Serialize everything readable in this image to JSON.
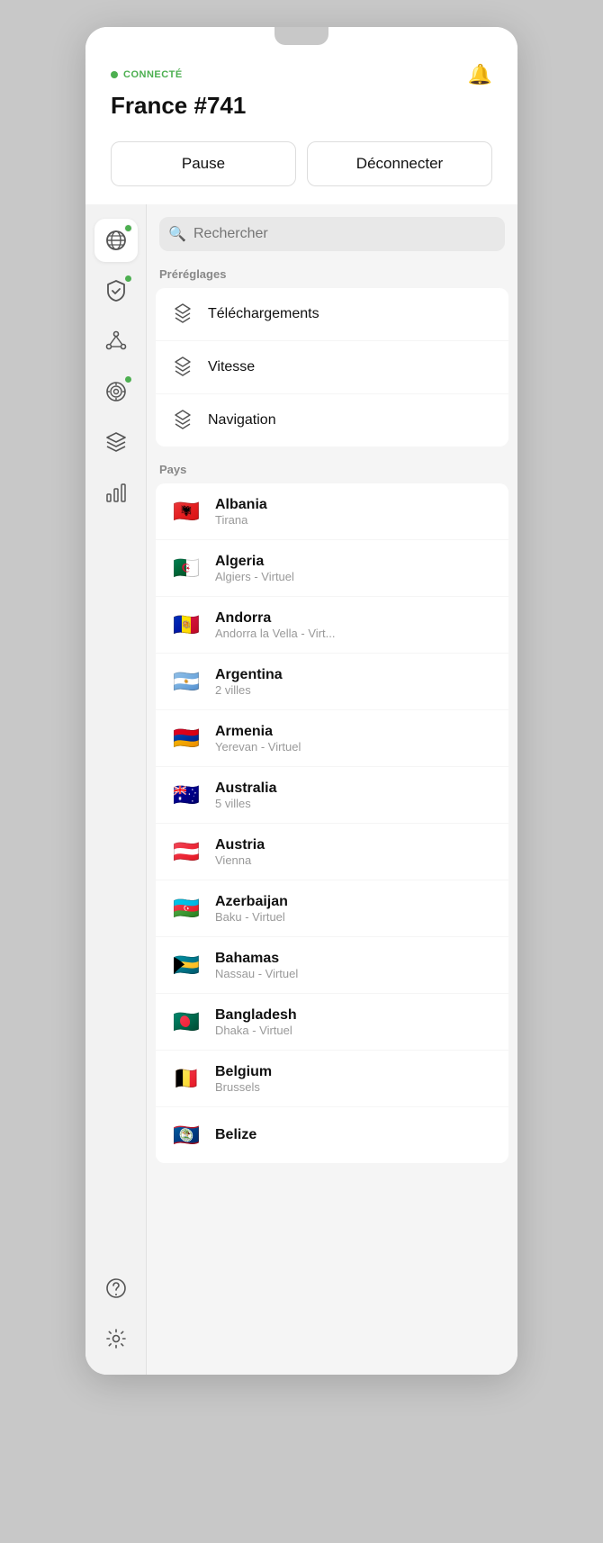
{
  "app": {
    "notch": true
  },
  "header": {
    "status_dot_color": "#4caf50",
    "status_label": "CONNECTÉ",
    "server_name": "France #741",
    "bell_icon": "🔔",
    "btn_pause": "Pause",
    "btn_disconnect": "Déconnecter"
  },
  "sidebar": {
    "items": [
      {
        "id": "globe",
        "icon": "globe",
        "badge": true,
        "active": true
      },
      {
        "id": "shield",
        "icon": "shield",
        "badge": true,
        "active": false
      },
      {
        "id": "nodes",
        "icon": "nodes",
        "badge": false,
        "active": false
      },
      {
        "id": "target",
        "icon": "target",
        "badge": true,
        "active": false
      },
      {
        "id": "layers",
        "icon": "layers",
        "badge": false,
        "active": false
      },
      {
        "id": "stats",
        "icon": "stats",
        "badge": false,
        "active": false
      }
    ],
    "bottom": [
      {
        "id": "help",
        "icon": "help"
      },
      {
        "id": "settings",
        "icon": "settings"
      }
    ]
  },
  "search": {
    "placeholder": "Rechercher"
  },
  "presets": {
    "section_label": "Préréglages",
    "items": [
      {
        "id": "downloads",
        "name": "Téléchargements"
      },
      {
        "id": "speed",
        "name": "Vitesse"
      },
      {
        "id": "navigation",
        "name": "Navigation"
      }
    ]
  },
  "countries": {
    "section_label": "Pays",
    "items": [
      {
        "id": "albania",
        "flag": "🇦🇱",
        "name": "Albania",
        "sub": "Tirana"
      },
      {
        "id": "algeria",
        "flag": "🇩🇿",
        "name": "Algeria",
        "sub": "Algiers - Virtuel"
      },
      {
        "id": "andorra",
        "flag": "🇦🇩",
        "name": "Andorra",
        "sub": "Andorra la Vella - Virt..."
      },
      {
        "id": "argentina",
        "flag": "🇦🇷",
        "name": "Argentina",
        "sub": "2 villes"
      },
      {
        "id": "armenia",
        "flag": "🇦🇲",
        "name": "Armenia",
        "sub": "Yerevan - Virtuel"
      },
      {
        "id": "australia",
        "flag": "🇦🇺",
        "name": "Australia",
        "sub": "5 villes"
      },
      {
        "id": "austria",
        "flag": "🇦🇹",
        "name": "Austria",
        "sub": "Vienna"
      },
      {
        "id": "azerbaijan",
        "flag": "🇦🇿",
        "name": "Azerbaijan",
        "sub": "Baku - Virtuel"
      },
      {
        "id": "bahamas",
        "flag": "🇧🇸",
        "name": "Bahamas",
        "sub": "Nassau - Virtuel"
      },
      {
        "id": "bangladesh",
        "flag": "🇧🇩",
        "name": "Bangladesh",
        "sub": "Dhaka - Virtuel"
      },
      {
        "id": "belgium",
        "flag": "🇧🇪",
        "name": "Belgium",
        "sub": "Brussels"
      },
      {
        "id": "belize",
        "flag": "🇧🇿",
        "name": "Belize",
        "sub": ""
      }
    ]
  }
}
